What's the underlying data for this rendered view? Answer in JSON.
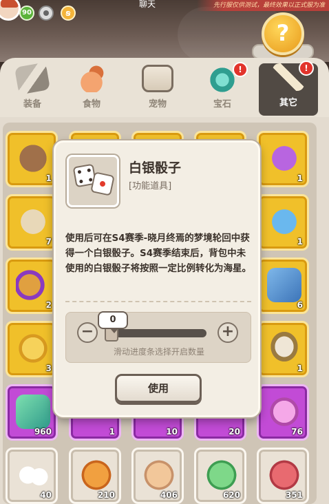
{
  "header": {
    "level": "90",
    "chat_label": "聊天",
    "test_notice": "先行服仅供测试，最终效果以正式服为准",
    "help_label": "?"
  },
  "tabs": [
    {
      "label": "装备",
      "icon": "wrench-icon",
      "active": false,
      "badge": null
    },
    {
      "label": "食物",
      "icon": "food-icon",
      "active": false,
      "badge": null
    },
    {
      "label": "宠物",
      "icon": "pet-icon",
      "active": false,
      "badge": null
    },
    {
      "label": "宝石",
      "icon": "gem-icon",
      "active": false,
      "badge": "!"
    },
    {
      "label": "其它",
      "icon": "bone-icon",
      "active": true,
      "badge": "!"
    }
  ],
  "inventory": {
    "col0": [
      {
        "rarity": "gold",
        "item": "chest-icon",
        "count": "1"
      },
      {
        "rarity": "gold",
        "item": "horned-chest-icon",
        "count": "7"
      },
      {
        "rarity": "gold",
        "item": "purple-bag-icon",
        "count": "2"
      },
      {
        "rarity": "gold",
        "item": "shell-coin-icon",
        "count": "3"
      },
      {
        "rarity": "purple",
        "item": "green-ticket-icon",
        "count": "960"
      },
      {
        "rarity": "white",
        "item": "dice-icon",
        "count": "40"
      }
    ],
    "col1_bottom": [
      {
        "rarity": "purple",
        "item": "teal-item-icon",
        "count": "1"
      },
      {
        "rarity": "white",
        "item": "orange-scroll-icon",
        "count": "210"
      }
    ],
    "col2_bottom": [
      {
        "rarity": "purple",
        "item": "red-item-icon",
        "count": "10"
      },
      {
        "rarity": "white",
        "item": "paw-scroll-icon",
        "count": "406"
      }
    ],
    "col3_bottom": [
      {
        "rarity": "purple",
        "item": "brown-item-icon",
        "count": "20"
      },
      {
        "rarity": "white",
        "item": "green-scroll-icon",
        "count": "620"
      }
    ],
    "col4": [
      {
        "rarity": "gold",
        "item": "purple-sack-icon",
        "count": "1"
      },
      {
        "rarity": "gold",
        "item": "blue-sack-icon",
        "count": "1"
      },
      {
        "rarity": "gold",
        "item": "blue-card-icon",
        "count": "6"
      },
      {
        "rarity": "gold",
        "item": "egg-nest-icon",
        "count": "1"
      },
      {
        "rarity": "purple",
        "item": "pink-crystal-icon",
        "count": "76"
      },
      {
        "rarity": "white",
        "item": "red-arrow-scroll-icon",
        "count": "351"
      }
    ]
  },
  "popup": {
    "title": "白银骰子",
    "category": "[功能道具]",
    "description": "使用后可在S4赛季-晓月终焉的梦境轮回中获得一个白银骰子。S4赛季结束后，背包中未使用的白银骰子将按照一定比例转化为海星。",
    "slider_value": "0",
    "slider_fraction": 0,
    "minus_label": "−",
    "plus_label": "+",
    "slider_hint": "滑动进度条选择开启数量",
    "use_button": "使用"
  },
  "colors": {
    "gold_slot": "#f0c02a",
    "purple_slot": "#c24bd6",
    "white_slot": "#eae2d6",
    "badge_red": "#e2342c",
    "active_tab": "#514a44"
  }
}
